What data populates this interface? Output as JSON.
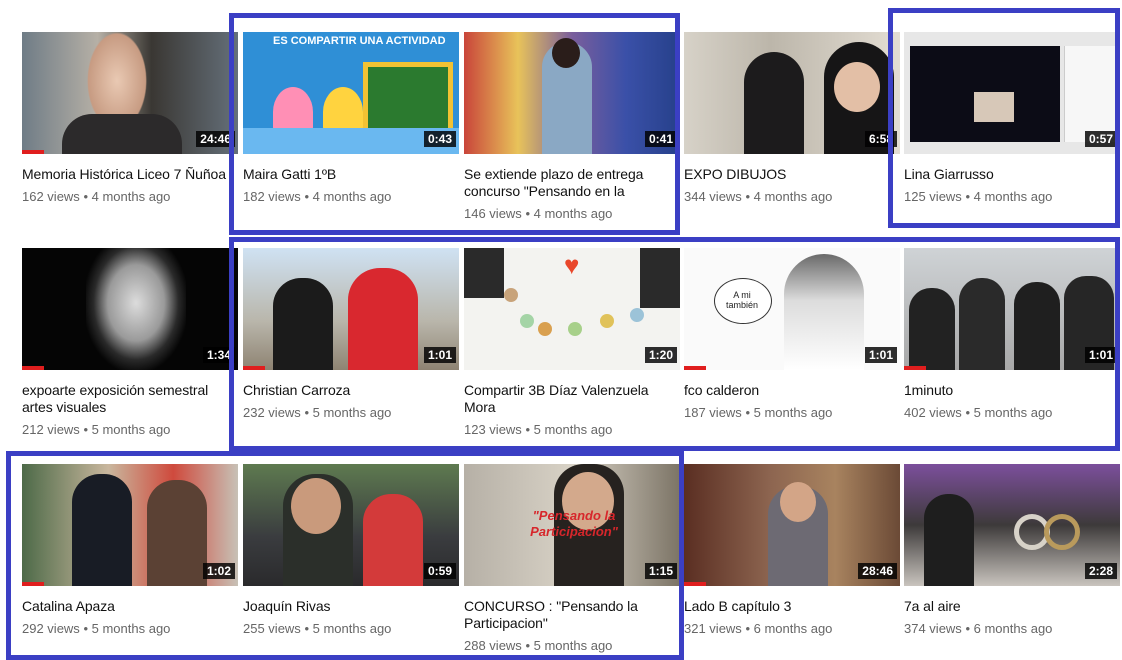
{
  "videos": [
    {
      "title": "Memoria Histórica Liceo 7 Ñuñoa",
      "views": "162 views",
      "age": "4 months ago",
      "duration": "24:46",
      "progress": 0.1
    },
    {
      "title": "Maira Gatti 1ºB",
      "views": "182 views",
      "age": "4 months ago",
      "duration": "0:43",
      "progress": 0.0,
      "overlay": "ES COMPARTIR UNA ACTIVIDAD"
    },
    {
      "title": "Se extiende plazo de entrega concurso \"Pensando en la",
      "views": "146 views",
      "age": "4 months ago",
      "duration": "0:41",
      "progress": 0.0
    },
    {
      "title": "EXPO DIBUJOS",
      "views": "344 views",
      "age": "4 months ago",
      "duration": "6:58",
      "progress": 0.0
    },
    {
      "title": "Lina Giarrusso",
      "views": "125 views",
      "age": "4 months ago",
      "duration": "0:57",
      "progress": 0.0
    },
    {
      "title": "expoarte exposición semestral artes visuales",
      "views": "212 views",
      "age": "5 months ago",
      "duration": "1:34",
      "progress": 0.1
    },
    {
      "title": "Christian Carroza",
      "views": "232 views",
      "age": "5 months ago",
      "duration": "1:01",
      "progress": 0.1
    },
    {
      "title": "Compartir 3B Díaz Valenzuela Mora",
      "views": "123 views",
      "age": "5 months ago",
      "duration": "1:20",
      "progress": 0.0
    },
    {
      "title": "fco calderon",
      "views": "187 views",
      "age": "5 months ago",
      "duration": "1:01",
      "progress": 0.1,
      "overlay": "A mi también"
    },
    {
      "title": "1minuto",
      "views": "402 views",
      "age": "5 months ago",
      "duration": "1:01",
      "progress": 0.1
    },
    {
      "title": "Catalina Apaza",
      "views": "292 views",
      "age": "5 months ago",
      "duration": "1:02",
      "progress": 0.1
    },
    {
      "title": "Joaquín Rivas",
      "views": "255 views",
      "age": "5 months ago",
      "duration": "0:59",
      "progress": 0.0
    },
    {
      "title": "CONCURSO : \"Pensando la Participacion\"",
      "views": "288 views",
      "age": "5 months ago",
      "duration": "1:15",
      "progress": 0.0,
      "overlay": "\"Pensando la Participacion\""
    },
    {
      "title": "Lado B capítulo 3",
      "views": "321 views",
      "age": "6 months ago",
      "duration": "28:46",
      "progress": 0.1
    },
    {
      "title": "7a al aire",
      "views": "374 views",
      "age": "6 months ago",
      "duration": "2:28",
      "progress": 0.0
    }
  ],
  "separator": "•",
  "colors": {
    "highlight": "#3b3fc4",
    "progress": "#e01e1e"
  }
}
